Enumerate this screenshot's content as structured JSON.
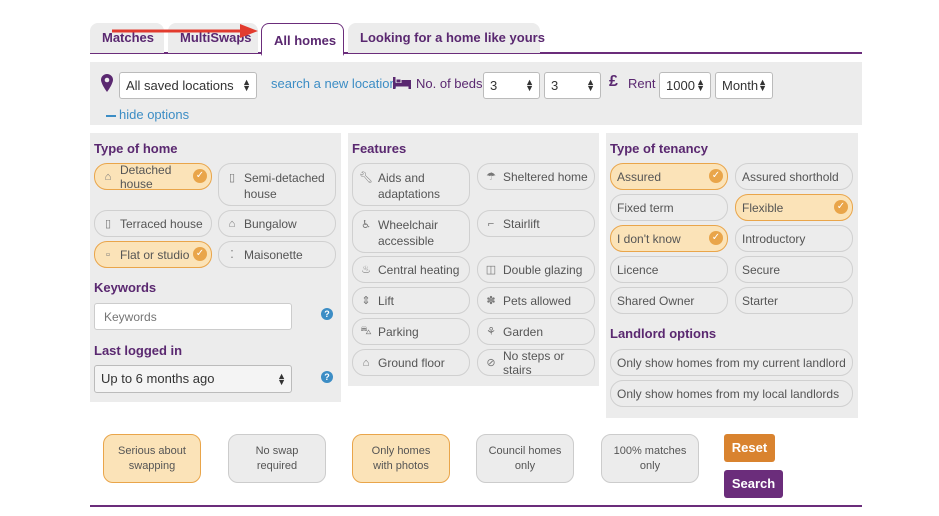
{
  "tabs": {
    "matches": "Matches",
    "multiswaps": "MultiSwaps",
    "all_homes": "All homes",
    "looking": "Looking for a home like yours"
  },
  "options": {
    "location_value": "All saved locations",
    "search_new_location": "search a new location",
    "beds_label": "No. of beds",
    "beds_min": "3",
    "beds_max": "3",
    "currency_symbol": "£",
    "rent_label": "Rent",
    "rent_value": "1000",
    "rent_period": "Month",
    "hide_options": "hide options"
  },
  "type_of_home": {
    "title": "Type of home",
    "items": [
      {
        "label": "Detached house",
        "selected": true,
        "icon": "house-icon"
      },
      {
        "label": "Semi-detached house",
        "selected": false,
        "icon": "semi-detached-icon"
      },
      {
        "label": "Terraced house",
        "selected": false,
        "icon": "terraced-icon"
      },
      {
        "label": "Bungalow",
        "selected": false,
        "icon": "bungalow-icon"
      },
      {
        "label": "Flat or studio",
        "selected": true,
        "icon": "flat-icon"
      },
      {
        "label": "Maisonette",
        "selected": false,
        "icon": "maisonette-icon"
      }
    ]
  },
  "keywords": {
    "title": "Keywords",
    "placeholder": "Keywords"
  },
  "last_logged_in": {
    "title": "Last logged in",
    "value": "Up to 6 months ago"
  },
  "features": {
    "title": "Features",
    "items": [
      {
        "label": "Aids and adaptations",
        "icon": "wrench-icon"
      },
      {
        "label": "Sheltered home",
        "icon": "umbrella-icon"
      },
      {
        "label": "Wheelchair accessible",
        "icon": "wheelchair-icon"
      },
      {
        "label": "Stairlift",
        "icon": "stairlift-icon"
      },
      {
        "label": "Central heating",
        "icon": "flame-icon"
      },
      {
        "label": "Double glazing",
        "icon": "window-icon"
      },
      {
        "label": "Lift",
        "icon": "lift-icon"
      },
      {
        "label": "Pets allowed",
        "icon": "paw-icon"
      },
      {
        "label": "Parking",
        "icon": "car-icon"
      },
      {
        "label": "Garden",
        "icon": "plant-icon"
      },
      {
        "label": "Ground floor",
        "icon": "ground-floor-icon"
      },
      {
        "label": "No steps or stairs",
        "icon": "no-steps-icon"
      }
    ]
  },
  "tenancy": {
    "title": "Type of tenancy",
    "items": [
      {
        "label": "Assured",
        "selected": true
      },
      {
        "label": "Assured shorthold",
        "selected": false
      },
      {
        "label": "Fixed term",
        "selected": false
      },
      {
        "label": "Flexible",
        "selected": true
      },
      {
        "label": "I don't know",
        "selected": true
      },
      {
        "label": "Introductory",
        "selected": false
      },
      {
        "label": "Licence",
        "selected": false
      },
      {
        "label": "Secure",
        "selected": false
      },
      {
        "label": "Shared Owner",
        "selected": false
      },
      {
        "label": "Starter",
        "selected": false
      }
    ]
  },
  "landlord": {
    "title": "Landlord options",
    "current": "Only show homes from my current landlord",
    "local": "Only show homes from my local landlords"
  },
  "bottom_filters": {
    "serious": "Serious about swapping",
    "no_swap": "No swap required",
    "photos": "Only homes with photos",
    "council": "Council homes only",
    "matches": "100% matches only"
  },
  "buttons": {
    "reset": "Reset",
    "search": "Search"
  },
  "colors": {
    "brand_purple": "#5a2870",
    "selected_fill": "#fbe3b8",
    "selected_border": "#e9a54a",
    "link_blue": "#3c8dc5",
    "reset_orange": "#d9832f",
    "arrow_red": "#e23b2e"
  }
}
